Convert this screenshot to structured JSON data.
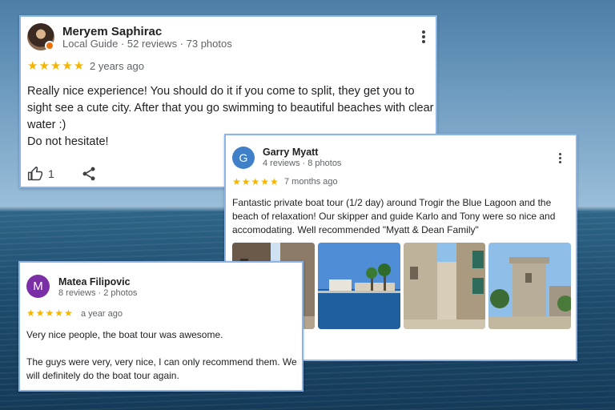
{
  "reviews": [
    {
      "name": "Meryem Saphirac",
      "meta": "Local Guide · 52 reviews · 73 photos",
      "stars": "★★★★★",
      "when": "2 years ago",
      "body_lines": [
        "Really nice experience! You should do it if you come to split, they get you to sight see a cute city. After that you go swimming to beautiful beaches with clear water :)",
        "Do not hesitate!"
      ],
      "likes": "1",
      "icons": {
        "like": "thumbs-up-icon",
        "share": "share-icon",
        "menu": "more-vert-icon",
        "badge": "local-guide-badge-icon"
      },
      "colors": {
        "badge": "#e8710a"
      }
    },
    {
      "name": "Garry Myatt",
      "initial": "G",
      "meta": "4 reviews · 8 photos",
      "stars": "★★★★★",
      "when": "7 months ago",
      "body": "Fantastic private boat tour (1/2 day) around Trogir the Blue Lagoon and the beach of relaxation! Our skipper and guide Karlo and Tony were so nice and accomodating. Well recommended \"Myatt & Dean Family\"",
      "photos": [
        "old-town-street-photo",
        "waterfront-promenade-photo",
        "narrow-alley-photo",
        "stone-tower-photo"
      ],
      "colors": {
        "avatar": "#3f80c8"
      }
    },
    {
      "name": "Matea Filipovic",
      "initial": "M",
      "meta": "8 reviews · 2 photos",
      "stars": "★★★★★",
      "when": "a year ago",
      "body_lines": [
        "Very nice people, the boat tour was awesome.",
        "The guys were very, very nice, I can only recommend them. We will definitely do the boat tour again."
      ],
      "colors": {
        "avatar": "#7b2fa6"
      }
    }
  ],
  "colors": {
    "star": "#f5b400",
    "card_border": "#8bb5e6"
  }
}
